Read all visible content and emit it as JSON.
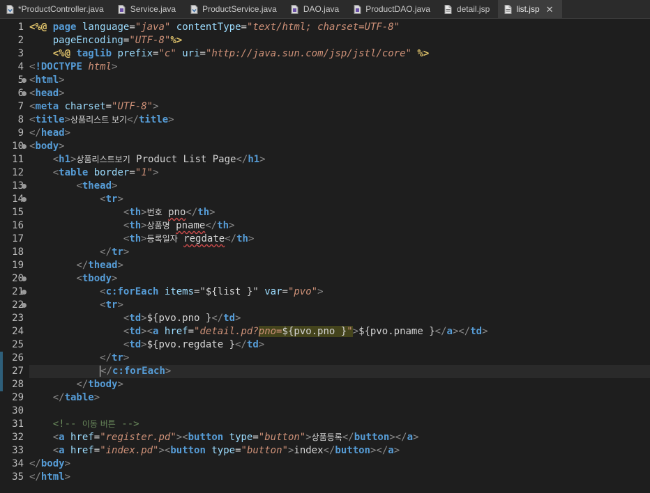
{
  "tabs": [
    {
      "label": "*ProductController.java",
      "icon": "java-file-icon"
    },
    {
      "label": "Service.java",
      "icon": "java-interface-file-icon"
    },
    {
      "label": "ProductService.java",
      "icon": "java-file-icon"
    },
    {
      "label": "DAO.java",
      "icon": "java-interface-file-icon"
    },
    {
      "label": "ProductDAO.java",
      "icon": "java-interface-file-icon"
    },
    {
      "label": "detail.jsp",
      "icon": "jsp-file-icon"
    },
    {
      "label": "list.jsp",
      "icon": "jsp-file-icon",
      "active": true,
      "close": "✕"
    }
  ],
  "line_numbers": [
    "1",
    "2",
    "3",
    "4",
    "5",
    "6",
    "7",
    "8",
    "9",
    "10",
    "11",
    "12",
    "13",
    "14",
    "15",
    "16",
    "17",
    "18",
    "19",
    "20",
    "21",
    "22",
    "23",
    "24",
    "25",
    "26",
    "27",
    "28",
    "29",
    "30",
    "31",
    "32",
    "33",
    "34",
    "35"
  ],
  "code_lines": [
    [
      {
        "c": "tk-d",
        "t": "<%@"
      },
      {
        "c": "tk-t",
        "t": " "
      },
      {
        "c": "tk-b",
        "t": "page"
      },
      {
        "c": "tk-t",
        "t": " "
      },
      {
        "c": "tk-a",
        "t": "language"
      },
      {
        "c": "tk-t",
        "t": "="
      },
      {
        "c": "tk-s",
        "t": "\"java\""
      },
      {
        "c": "tk-t",
        "t": " "
      },
      {
        "c": "tk-a",
        "t": "contentType"
      },
      {
        "c": "tk-t",
        "t": "="
      },
      {
        "c": "tk-s",
        "t": "\"text/html; charset=UTF-8\""
      }
    ],
    [
      {
        "c": "tk-t",
        "t": "    "
      },
      {
        "c": "tk-a",
        "t": "pageEncoding"
      },
      {
        "c": "tk-t",
        "t": "="
      },
      {
        "c": "tk-s",
        "t": "\"UTF-8\""
      },
      {
        "c": "tk-d",
        "t": "%>"
      }
    ],
    [
      {
        "c": "tk-t",
        "t": "    "
      },
      {
        "c": "tk-d",
        "t": "<%@"
      },
      {
        "c": "tk-t",
        "t": " "
      },
      {
        "c": "tk-b",
        "t": "taglib"
      },
      {
        "c": "tk-t",
        "t": " "
      },
      {
        "c": "tk-a",
        "t": "prefix"
      },
      {
        "c": "tk-t",
        "t": "="
      },
      {
        "c": "tk-s",
        "t": "\"c\""
      },
      {
        "c": "tk-t",
        "t": " "
      },
      {
        "c": "tk-a",
        "t": "uri"
      },
      {
        "c": "tk-t",
        "t": "="
      },
      {
        "c": "tk-s",
        "t": "\"http://java.sun.com/jsp/jstl/core\""
      },
      {
        "c": "tk-t",
        "t": " "
      },
      {
        "c": "tk-d",
        "t": "%>"
      }
    ],
    [
      {
        "c": "tk-br",
        "t": "<"
      },
      {
        "c": "tk-b",
        "t": "!DOCTYPE"
      },
      {
        "c": "tk-t",
        "t": " "
      },
      {
        "c": "tk-s",
        "t": "html"
      },
      {
        "c": "tk-br",
        "t": ">"
      }
    ],
    [
      {
        "c": "tk-br",
        "t": "<"
      },
      {
        "c": "tk-b",
        "t": "html"
      },
      {
        "c": "tk-br",
        "t": ">"
      }
    ],
    [
      {
        "c": "tk-br",
        "t": "<"
      },
      {
        "c": "tk-b",
        "t": "head"
      },
      {
        "c": "tk-br",
        "t": ">"
      }
    ],
    [
      {
        "c": "tk-br",
        "t": "<"
      },
      {
        "c": "tk-b",
        "t": "meta"
      },
      {
        "c": "tk-t",
        "t": " "
      },
      {
        "c": "tk-a",
        "t": "charset"
      },
      {
        "c": "tk-t",
        "t": "="
      },
      {
        "c": "tk-s",
        "t": "\"UTF-8\""
      },
      {
        "c": "tk-br",
        "t": ">"
      }
    ],
    [
      {
        "c": "tk-br",
        "t": "<"
      },
      {
        "c": "tk-b",
        "t": "title"
      },
      {
        "c": "tk-br",
        "t": ">"
      },
      {
        "c": "tk-t tk-k",
        "t": "상품리스트 보기"
      },
      {
        "c": "tk-br",
        "t": "</"
      },
      {
        "c": "tk-b",
        "t": "title"
      },
      {
        "c": "tk-br",
        "t": ">"
      }
    ],
    [
      {
        "c": "tk-br",
        "t": "</"
      },
      {
        "c": "tk-b",
        "t": "head"
      },
      {
        "c": "tk-br",
        "t": ">"
      }
    ],
    [
      {
        "c": "tk-br",
        "t": "<"
      },
      {
        "c": "tk-b",
        "t": "body"
      },
      {
        "c": "tk-br",
        "t": ">"
      }
    ],
    [
      {
        "c": "tk-t",
        "t": "    "
      },
      {
        "c": "tk-br",
        "t": "<"
      },
      {
        "c": "tk-b",
        "t": "h1"
      },
      {
        "c": "tk-br",
        "t": ">"
      },
      {
        "c": "tk-t tk-k",
        "t": "상품리스트보기"
      },
      {
        "c": "tk-t",
        "t": " Product List Page"
      },
      {
        "c": "tk-br",
        "t": "</"
      },
      {
        "c": "tk-b",
        "t": "h1"
      },
      {
        "c": "tk-br",
        "t": ">"
      }
    ],
    [
      {
        "c": "tk-t",
        "t": "    "
      },
      {
        "c": "tk-br",
        "t": "<"
      },
      {
        "c": "tk-b",
        "t": "table"
      },
      {
        "c": "tk-t",
        "t": " "
      },
      {
        "c": "tk-a",
        "t": "border"
      },
      {
        "c": "tk-t",
        "t": "="
      },
      {
        "c": "tk-s",
        "t": "\"1\""
      },
      {
        "c": "tk-br",
        "t": ">"
      }
    ],
    [
      {
        "c": "tk-t",
        "t": "        "
      },
      {
        "c": "tk-br",
        "t": "<"
      },
      {
        "c": "tk-b",
        "t": "thead"
      },
      {
        "c": "tk-br",
        "t": ">"
      }
    ],
    [
      {
        "c": "tk-t",
        "t": "            "
      },
      {
        "c": "tk-br",
        "t": "<"
      },
      {
        "c": "tk-b",
        "t": "tr"
      },
      {
        "c": "tk-br",
        "t": ">"
      }
    ],
    [
      {
        "c": "tk-t",
        "t": "                "
      },
      {
        "c": "tk-br",
        "t": "<"
      },
      {
        "c": "tk-b",
        "t": "th"
      },
      {
        "c": "tk-br",
        "t": ">"
      },
      {
        "c": "tk-t tk-k",
        "t": "번호"
      },
      {
        "c": "tk-t",
        "t": " "
      },
      {
        "c": "tk-t u",
        "t": "pno"
      },
      {
        "c": "tk-br",
        "t": "</"
      },
      {
        "c": "tk-b",
        "t": "th"
      },
      {
        "c": "tk-br",
        "t": ">"
      }
    ],
    [
      {
        "c": "tk-t",
        "t": "                "
      },
      {
        "c": "tk-br",
        "t": "<"
      },
      {
        "c": "tk-b",
        "t": "th"
      },
      {
        "c": "tk-br",
        "t": ">"
      },
      {
        "c": "tk-t tk-k",
        "t": "상품명"
      },
      {
        "c": "tk-t",
        "t": " "
      },
      {
        "c": "tk-t u",
        "t": "pname"
      },
      {
        "c": "tk-br",
        "t": "</"
      },
      {
        "c": "tk-b",
        "t": "th"
      },
      {
        "c": "tk-br",
        "t": ">"
      }
    ],
    [
      {
        "c": "tk-t",
        "t": "                "
      },
      {
        "c": "tk-br",
        "t": "<"
      },
      {
        "c": "tk-b",
        "t": "th"
      },
      {
        "c": "tk-br",
        "t": ">"
      },
      {
        "c": "tk-t tk-k",
        "t": "등록일자"
      },
      {
        "c": "tk-t",
        "t": " "
      },
      {
        "c": "tk-t u",
        "t": "regdate"
      },
      {
        "c": "tk-br",
        "t": "</"
      },
      {
        "c": "tk-b",
        "t": "th"
      },
      {
        "c": "tk-br",
        "t": ">"
      }
    ],
    [
      {
        "c": "tk-t",
        "t": "            "
      },
      {
        "c": "tk-br",
        "t": "</"
      },
      {
        "c": "tk-b",
        "t": "tr"
      },
      {
        "c": "tk-br",
        "t": ">"
      }
    ],
    [
      {
        "c": "tk-t",
        "t": "        "
      },
      {
        "c": "tk-br",
        "t": "</"
      },
      {
        "c": "tk-b",
        "t": "thead"
      },
      {
        "c": "tk-br",
        "t": ">"
      }
    ],
    [
      {
        "c": "tk-t",
        "t": "        "
      },
      {
        "c": "tk-br",
        "t": "<"
      },
      {
        "c": "tk-b",
        "t": "tbody"
      },
      {
        "c": "tk-br",
        "t": ">"
      }
    ],
    [
      {
        "c": "tk-t",
        "t": "            "
      },
      {
        "c": "tk-br",
        "t": "<"
      },
      {
        "c": "tk-b",
        "t": "c:forEach"
      },
      {
        "c": "tk-t",
        "t": " "
      },
      {
        "c": "tk-a",
        "t": "items"
      },
      {
        "c": "tk-t",
        "t": "="
      },
      {
        "c": "tk-t",
        "t": "\"${list }\""
      },
      {
        "c": "tk-t",
        "t": " "
      },
      {
        "c": "tk-a",
        "t": "var"
      },
      {
        "c": "tk-t",
        "t": "="
      },
      {
        "c": "tk-s",
        "t": "\"pvo\""
      },
      {
        "c": "tk-br",
        "t": ">"
      }
    ],
    [
      {
        "c": "tk-t",
        "t": "            "
      },
      {
        "c": "tk-br",
        "t": "<"
      },
      {
        "c": "tk-b",
        "t": "tr"
      },
      {
        "c": "tk-br",
        "t": ">"
      }
    ],
    [
      {
        "c": "tk-t",
        "t": "                "
      },
      {
        "c": "tk-br",
        "t": "<"
      },
      {
        "c": "tk-b",
        "t": "td"
      },
      {
        "c": "tk-br",
        "t": ">"
      },
      {
        "c": "tk-t",
        "t": "${pvo.pno }"
      },
      {
        "c": "tk-br",
        "t": "</"
      },
      {
        "c": "tk-b",
        "t": "td"
      },
      {
        "c": "tk-br",
        "t": ">"
      }
    ],
    [
      {
        "c": "tk-t",
        "t": "                "
      },
      {
        "c": "tk-br",
        "t": "<"
      },
      {
        "c": "tk-b",
        "t": "td"
      },
      {
        "c": "tk-br",
        "t": "><"
      },
      {
        "c": "tk-b",
        "t": "a"
      },
      {
        "c": "tk-t",
        "t": " "
      },
      {
        "c": "tk-a",
        "t": "href"
      },
      {
        "c": "tk-t",
        "t": "="
      },
      {
        "c": "tk-s",
        "t": "\"detail.pd?"
      },
      {
        "c": "tk-s hl",
        "t": "pno="
      },
      {
        "c": "tk-t hl",
        "t": "${pvo.pno }"
      },
      {
        "c": "tk-s hl",
        "t": "\""
      },
      {
        "c": "tk-br",
        "t": ">"
      },
      {
        "c": "tk-t",
        "t": "${pvo.pname }"
      },
      {
        "c": "tk-br",
        "t": "</"
      },
      {
        "c": "tk-b",
        "t": "a"
      },
      {
        "c": "tk-br",
        "t": "></"
      },
      {
        "c": "tk-b",
        "t": "td"
      },
      {
        "c": "tk-br",
        "t": ">"
      }
    ],
    [
      {
        "c": "tk-t",
        "t": "                "
      },
      {
        "c": "tk-br",
        "t": "<"
      },
      {
        "c": "tk-b",
        "t": "td"
      },
      {
        "c": "tk-br",
        "t": ">"
      },
      {
        "c": "tk-t",
        "t": "${pvo.regdate }"
      },
      {
        "c": "tk-br",
        "t": "</"
      },
      {
        "c": "tk-b",
        "t": "td"
      },
      {
        "c": "tk-br",
        "t": ">"
      }
    ],
    [
      {
        "c": "tk-t",
        "t": "            "
      },
      {
        "c": "tk-br",
        "t": "</"
      },
      {
        "c": "tk-b",
        "t": "tr"
      },
      {
        "c": "tk-br",
        "t": ">"
      }
    ],
    [
      {
        "c": "tk-t",
        "t": "            "
      },
      {
        "c": "caret",
        "t": ""
      },
      {
        "c": "tk-br",
        "t": "</"
      },
      {
        "c": "tk-b",
        "t": "c:forEach"
      },
      {
        "c": "tk-br",
        "t": ">"
      }
    ],
    [
      {
        "c": "tk-t",
        "t": "        "
      },
      {
        "c": "tk-br",
        "t": "</"
      },
      {
        "c": "tk-b",
        "t": "tbody"
      },
      {
        "c": "tk-br",
        "t": ">"
      }
    ],
    [
      {
        "c": "tk-t",
        "t": "    "
      },
      {
        "c": "tk-br",
        "t": "</"
      },
      {
        "c": "tk-b",
        "t": "table"
      },
      {
        "c": "tk-br",
        "t": ">"
      }
    ],
    [],
    [
      {
        "c": "tk-t",
        "t": "    "
      },
      {
        "c": "tk-c",
        "t": "<!-- "
      },
      {
        "c": "tk-c tk-k",
        "t": "이동 버튼"
      },
      {
        "c": "tk-c",
        "t": " -->"
      }
    ],
    [
      {
        "c": "tk-t",
        "t": "    "
      },
      {
        "c": "tk-br",
        "t": "<"
      },
      {
        "c": "tk-b",
        "t": "a"
      },
      {
        "c": "tk-t",
        "t": " "
      },
      {
        "c": "tk-a",
        "t": "href"
      },
      {
        "c": "tk-t",
        "t": "="
      },
      {
        "c": "tk-s",
        "t": "\"register.pd\""
      },
      {
        "c": "tk-br",
        "t": "><"
      },
      {
        "c": "tk-b",
        "t": "button"
      },
      {
        "c": "tk-t",
        "t": " "
      },
      {
        "c": "tk-a",
        "t": "type"
      },
      {
        "c": "tk-t",
        "t": "="
      },
      {
        "c": "tk-s",
        "t": "\"button\""
      },
      {
        "c": "tk-br",
        "t": ">"
      },
      {
        "c": "tk-t tk-k",
        "t": "상품등록"
      },
      {
        "c": "tk-br",
        "t": "</"
      },
      {
        "c": "tk-b",
        "t": "button"
      },
      {
        "c": "tk-br",
        "t": "></"
      },
      {
        "c": "tk-b",
        "t": "a"
      },
      {
        "c": "tk-br",
        "t": ">"
      }
    ],
    [
      {
        "c": "tk-t",
        "t": "    "
      },
      {
        "c": "tk-br",
        "t": "<"
      },
      {
        "c": "tk-b",
        "t": "a"
      },
      {
        "c": "tk-t",
        "t": " "
      },
      {
        "c": "tk-a",
        "t": "href"
      },
      {
        "c": "tk-t",
        "t": "="
      },
      {
        "c": "tk-s",
        "t": "\"index.pd\""
      },
      {
        "c": "tk-br",
        "t": "><"
      },
      {
        "c": "tk-b",
        "t": "button"
      },
      {
        "c": "tk-t",
        "t": " "
      },
      {
        "c": "tk-a",
        "t": "type"
      },
      {
        "c": "tk-t",
        "t": "="
      },
      {
        "c": "tk-s",
        "t": "\"button\""
      },
      {
        "c": "tk-br",
        "t": ">"
      },
      {
        "c": "tk-t",
        "t": "index"
      },
      {
        "c": "tk-br",
        "t": "</"
      },
      {
        "c": "tk-b",
        "t": "button"
      },
      {
        "c": "tk-br",
        "t": "></"
      },
      {
        "c": "tk-b",
        "t": "a"
      },
      {
        "c": "tk-br",
        "t": ">"
      }
    ],
    [
      {
        "c": "tk-br",
        "t": "</"
      },
      {
        "c": "tk-b",
        "t": "body"
      },
      {
        "c": "tk-br",
        "t": ">"
      }
    ],
    [
      {
        "c": "tk-br",
        "t": "</"
      },
      {
        "c": "tk-b",
        "t": "html"
      },
      {
        "c": "tk-br",
        "t": ">"
      }
    ]
  ],
  "fold_lines": [
    5,
    6,
    10,
    13,
    14,
    20,
    21,
    22
  ],
  "modified_lines": [
    26,
    27,
    28
  ],
  "current_line": 27,
  "colors": {
    "background": "#1e1e1e",
    "keyword": "#569cd6",
    "attribute": "#9cdcfe",
    "string": "#ce9178",
    "directive": "#e0c36b",
    "search_highlight": "#44441c"
  }
}
